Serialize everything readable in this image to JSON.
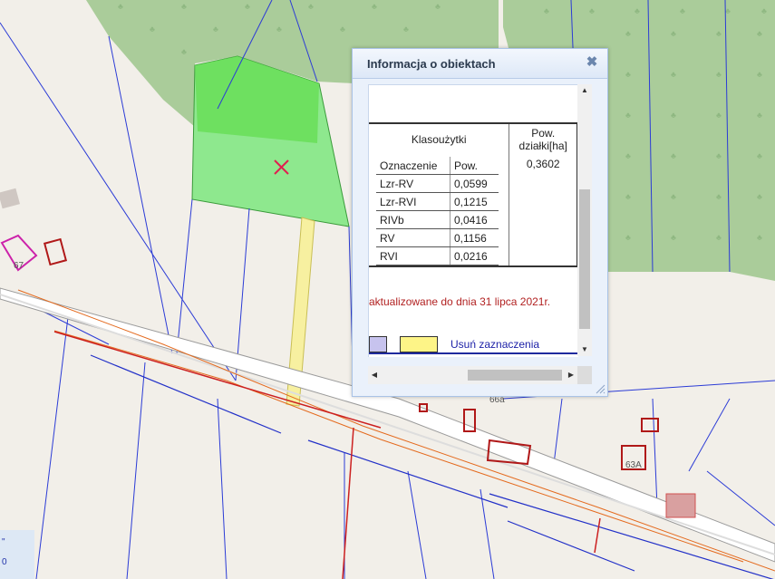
{
  "map": {
    "labels": [
      "67",
      "66a",
      "63A",
      "0",
      "\""
    ],
    "colors": {
      "background": "#f2efe9",
      "forest": "#aacc9a",
      "selected_parcel": "#8ee88e",
      "selected_highlight": "#66dd55",
      "road_strip": "#f7f0a0",
      "parcel_lines": "#2b3bd6",
      "buildings": "#b01818",
      "utility_line": "#e46a1e"
    },
    "marker_icon": "cross-marker-icon"
  },
  "popup": {
    "title": "Informacja o obiektach",
    "close_icon": "close-icon",
    "table": {
      "header_land_use": "Klasoużytki",
      "header_area": "Pow. działki[ha]",
      "col_code": "Oznaczenie",
      "col_area": "Pow.",
      "total_area": "0,3602",
      "rows": [
        {
          "code": "Lzr-RV",
          "area": "0,0599"
        },
        {
          "code": "Lzr-RVI",
          "area": "0,1215"
        },
        {
          "code": "RIVb",
          "area": "0,0416"
        },
        {
          "code": "RV",
          "area": "0,1156"
        },
        {
          "code": "RVI",
          "area": "0,0216"
        }
      ]
    },
    "update_note": "aktualizowane do dnia 31 lipca 2021r.",
    "clear_link": "Usuń zaznaczenia",
    "swatch_colors": {
      "blue": "#c7c3ee",
      "yellow": "#fdf487"
    }
  }
}
